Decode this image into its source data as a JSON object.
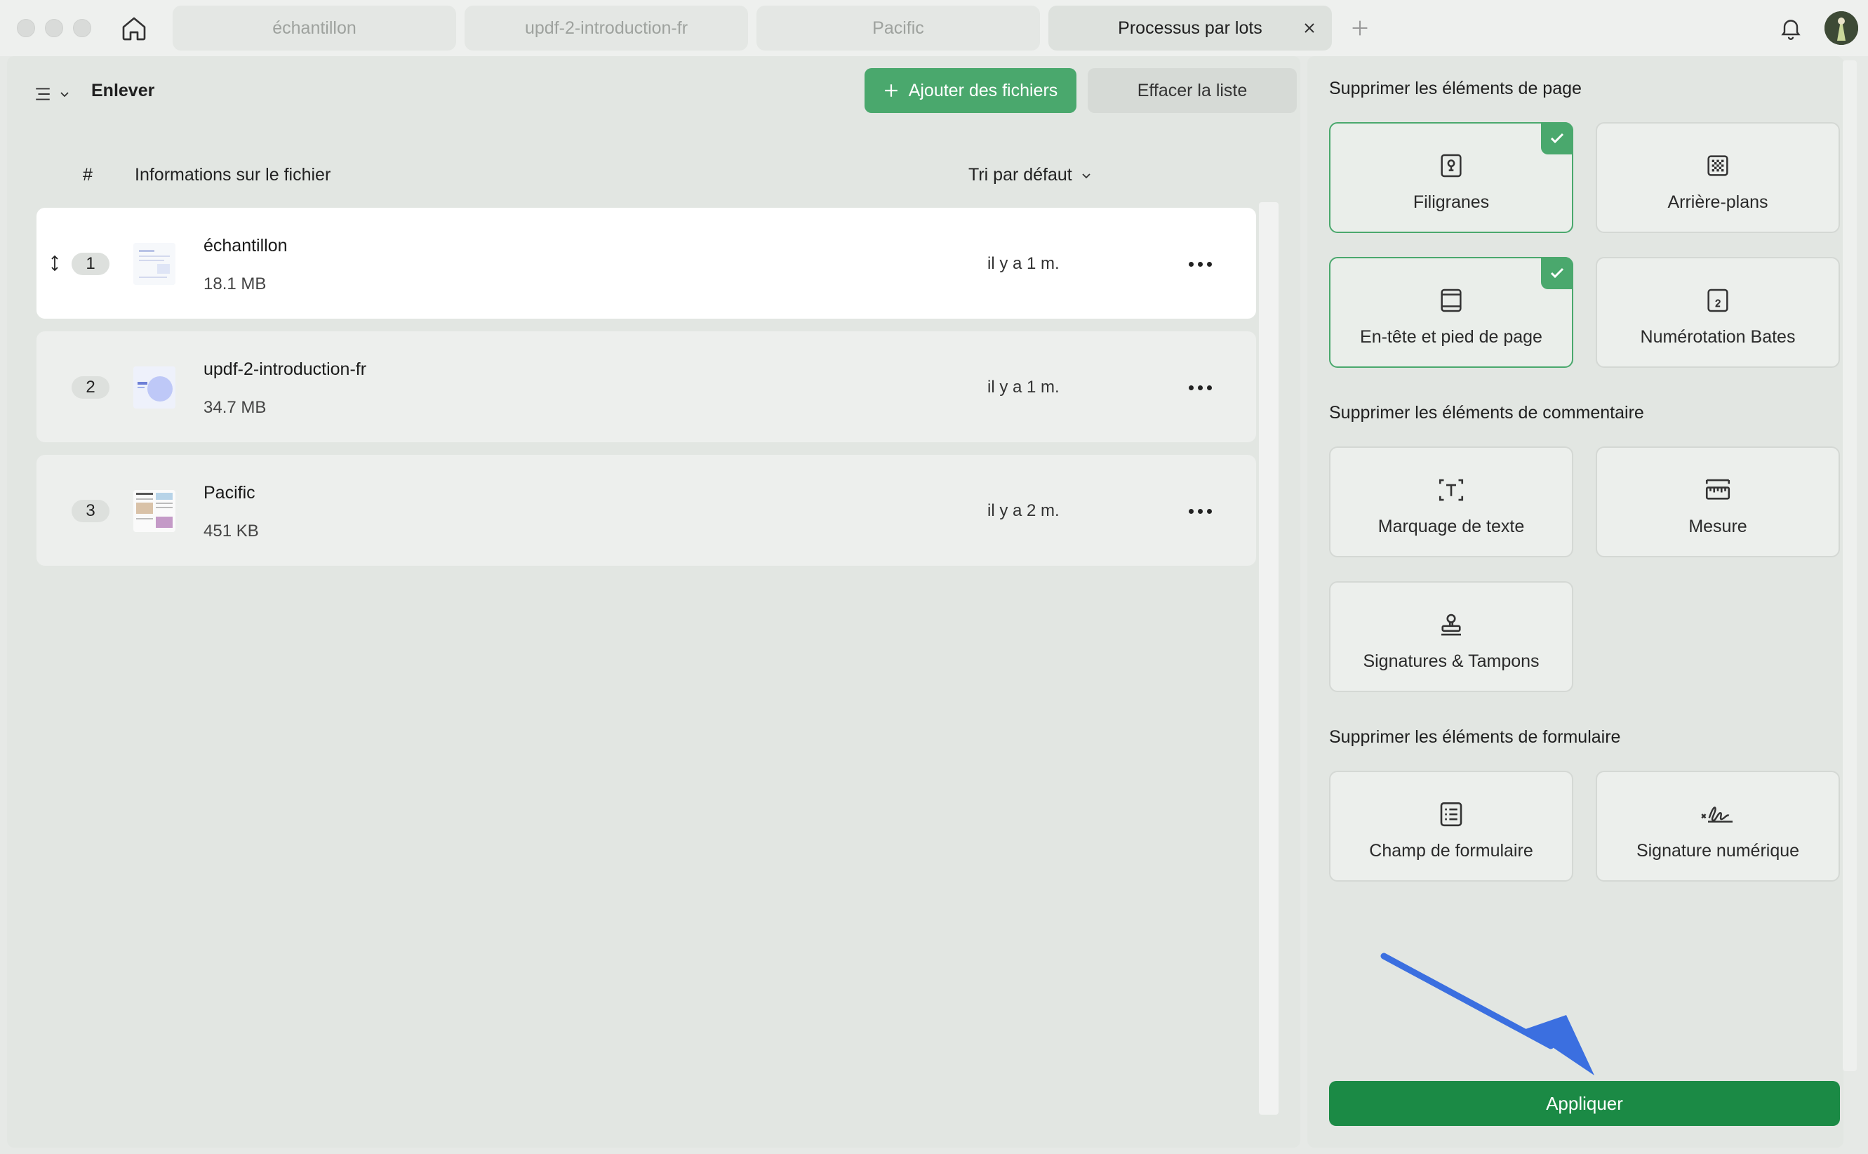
{
  "tabs": [
    {
      "label": "échantillon"
    },
    {
      "label": "updf-2-introduction-fr"
    },
    {
      "label": "Pacific"
    },
    {
      "label": "Processus par lots"
    }
  ],
  "left": {
    "title": "Enlever",
    "add_files_label": "Ajouter des fichiers",
    "clear_list_label": "Effacer la liste",
    "columns": {
      "hash": "#",
      "info": "Informations sur le fichier",
      "sort": "Tri par défaut"
    },
    "files": [
      {
        "num": "1",
        "name": "échantillon",
        "size": "18.1 MB",
        "time": "il y a 1 m."
      },
      {
        "num": "2",
        "name": "updf-2-introduction-fr",
        "size": "34.7 MB",
        "time": "il y a 1 m."
      },
      {
        "num": "3",
        "name": "Pacific",
        "size": "451 KB",
        "time": "il y a 2 m."
      }
    ]
  },
  "right": {
    "page_section": "Supprimer les éléments de page",
    "comment_section": "Supprimer les éléments de commentaire",
    "form_section": "Supprimer les éléments de formulaire",
    "options": {
      "watermarks": {
        "label": "Filigranes",
        "checked": true,
        "icon": "watermark-icon"
      },
      "backgrounds": {
        "label": "Arrière-plans",
        "checked": false,
        "icon": "background-icon"
      },
      "header_footer": {
        "label": "En-tête et pied de page",
        "checked": true,
        "icon": "header-footer-icon"
      },
      "bates": {
        "label": "Numérotation Bates",
        "checked": false,
        "icon": "bates-icon"
      },
      "text_markup": {
        "label": "Marquage de texte",
        "checked": false,
        "icon": "text-markup-icon"
      },
      "measure": {
        "label": "Mesure",
        "checked": false,
        "icon": "ruler-icon"
      },
      "signatures": {
        "label": "Signatures & Tampons",
        "checked": false,
        "icon": "stamp-icon"
      },
      "form_field": {
        "label": "Champ de formulaire",
        "checked": false,
        "icon": "form-field-icon"
      },
      "digital_signature": {
        "label": "Signature numérique",
        "checked": false,
        "icon": "digital-signature-icon"
      }
    },
    "apply_label": "Appliquer"
  },
  "colors": {
    "accent": "#4aa86d",
    "apply": "#1b8a45",
    "arrow": "#3b6fe0"
  }
}
